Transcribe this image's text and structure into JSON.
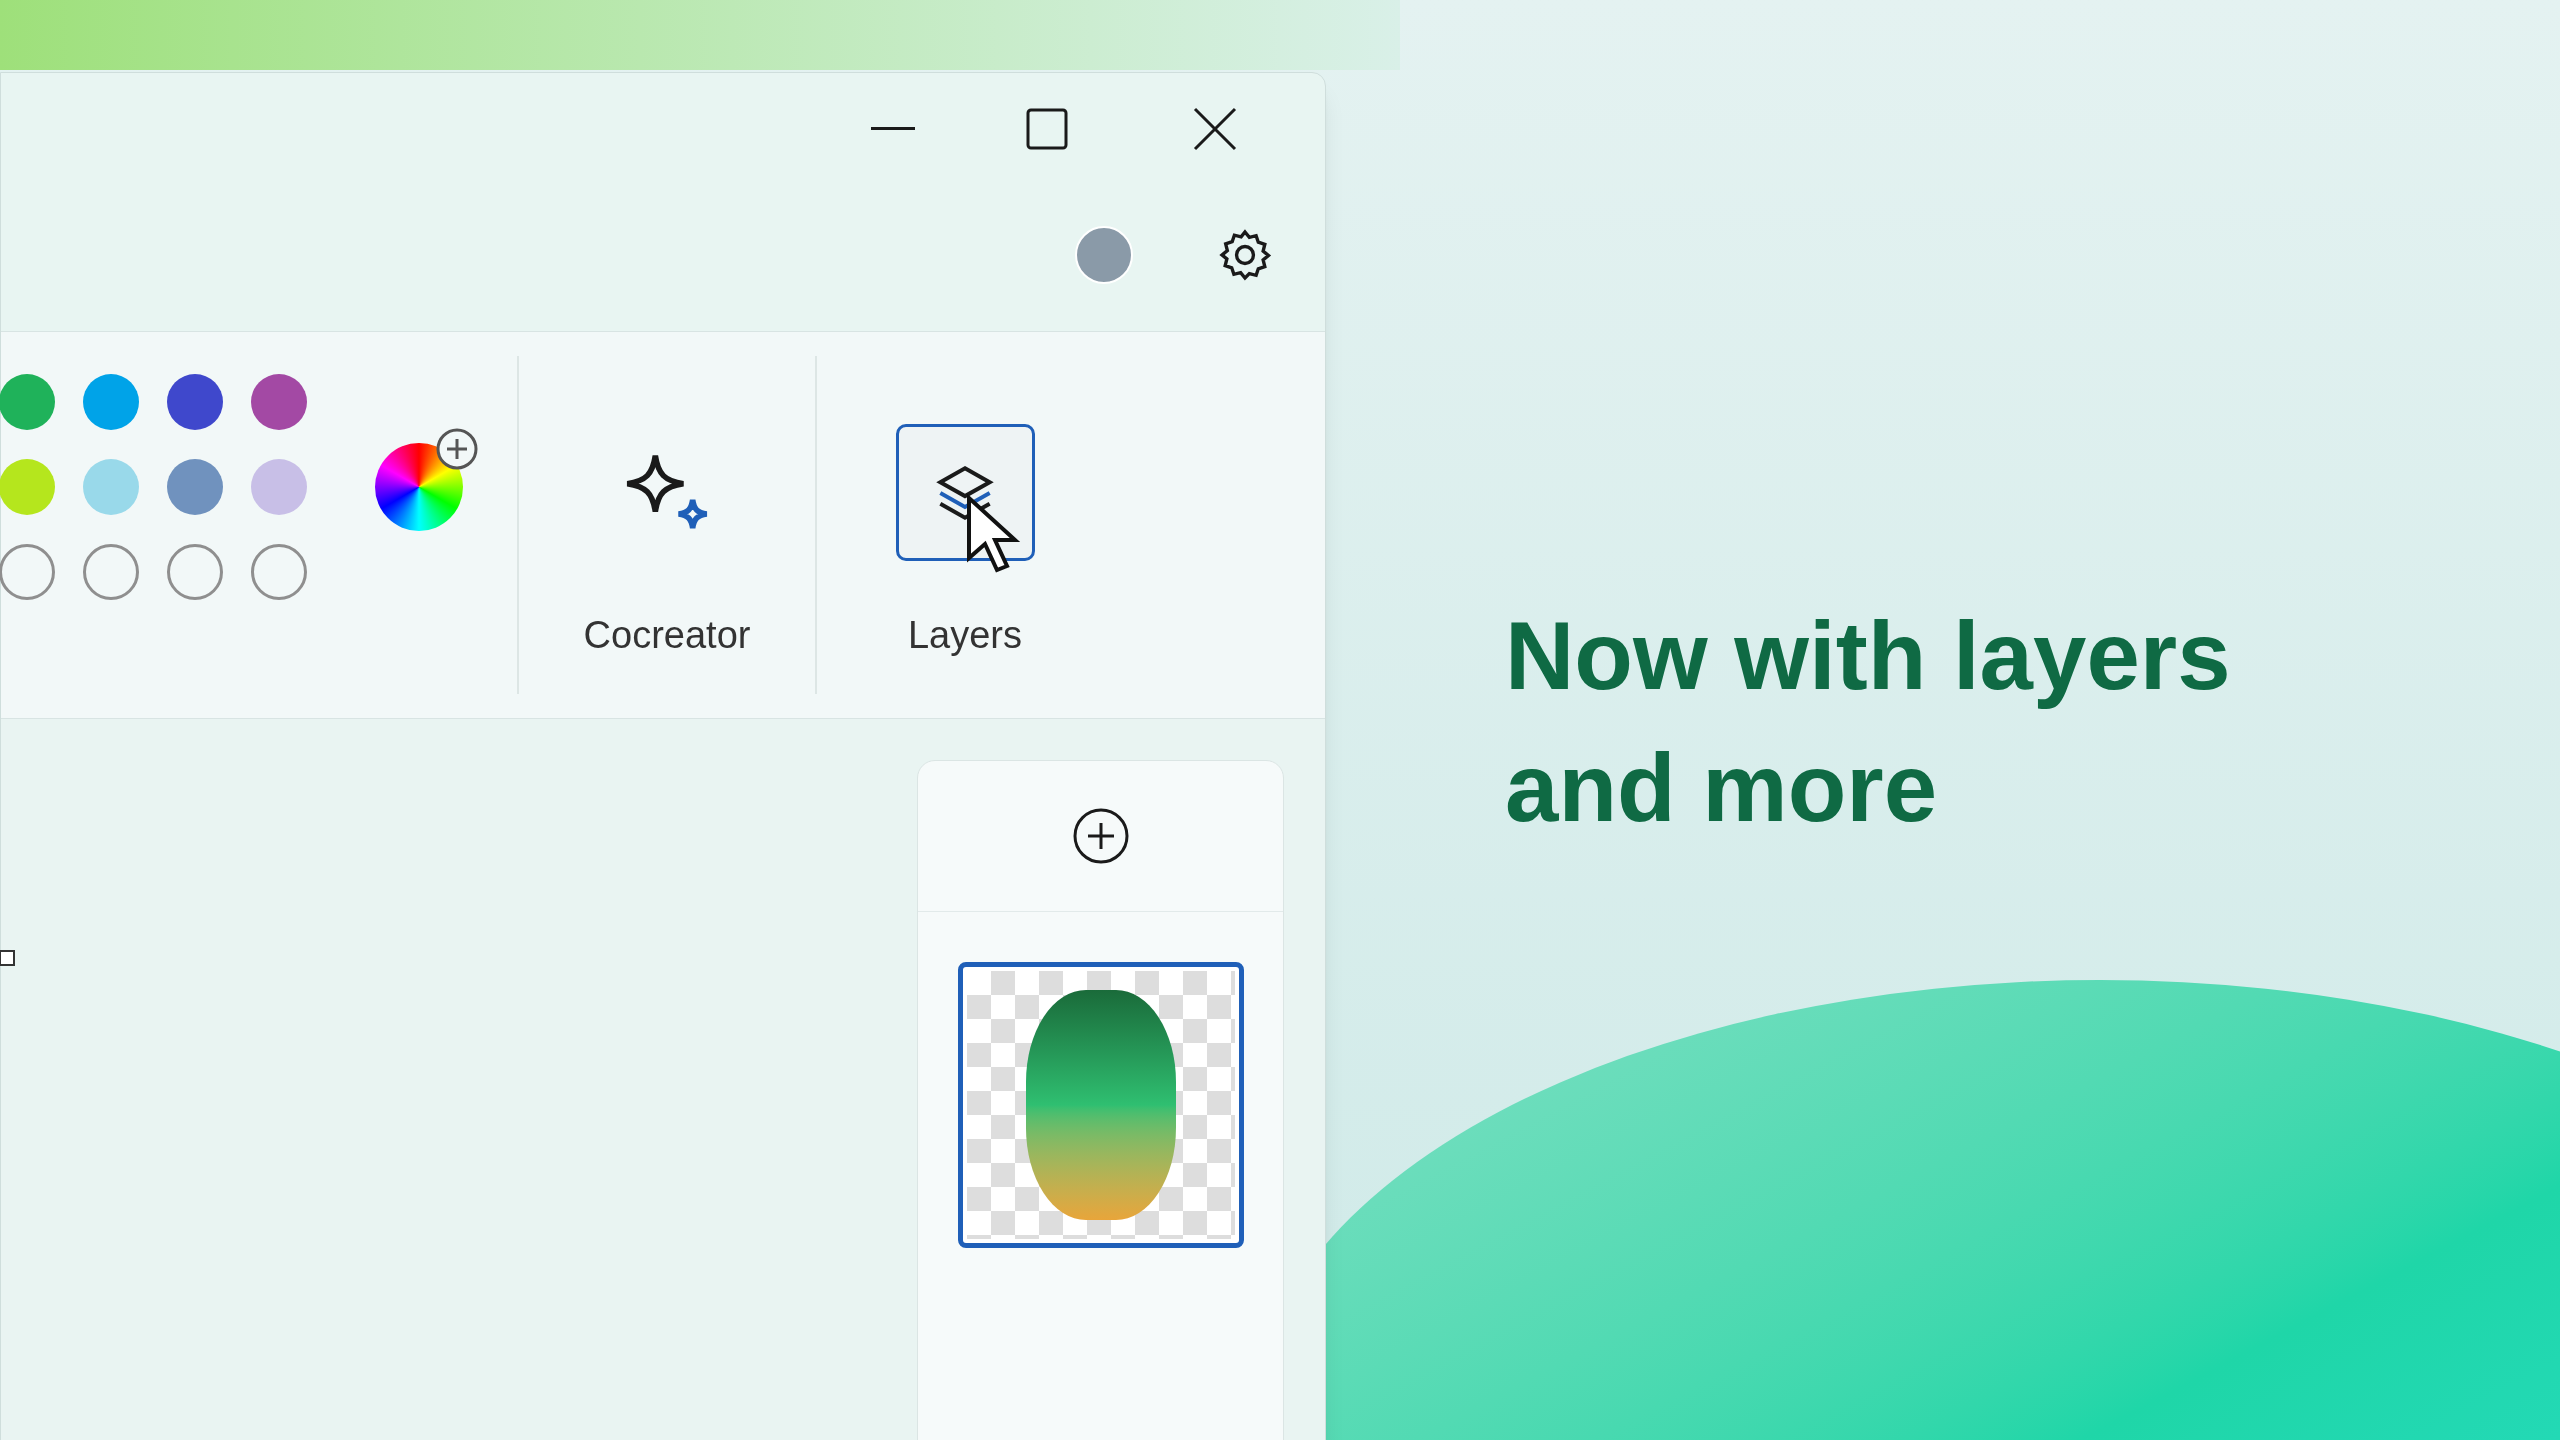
{
  "palette": [
    {
      "kind": "filled",
      "color": "#1fb25a"
    },
    {
      "kind": "filled",
      "color": "#00a3e8"
    },
    {
      "kind": "filled",
      "color": "#3f48cc"
    },
    {
      "kind": "filled",
      "color": "#a349a4"
    },
    {
      "kind": "filled",
      "color": "#b5e61d"
    },
    {
      "kind": "filled",
      "color": "#99d9ea"
    },
    {
      "kind": "filled",
      "color": "#7092be"
    },
    {
      "kind": "filled",
      "color": "#c8bfe7"
    },
    {
      "kind": "empty"
    },
    {
      "kind": "empty"
    },
    {
      "kind": "empty"
    },
    {
      "kind": "empty"
    }
  ],
  "tools": [
    {
      "kind": "cocreator",
      "label": "Cocreator",
      "selected": false
    },
    {
      "kind": "layers",
      "label": "Layers",
      "selected": true
    }
  ],
  "layers_panel": {
    "layers": [
      {
        "selected": true
      }
    ]
  },
  "headline_lines": [
    "Now with layers",
    "and more"
  ]
}
